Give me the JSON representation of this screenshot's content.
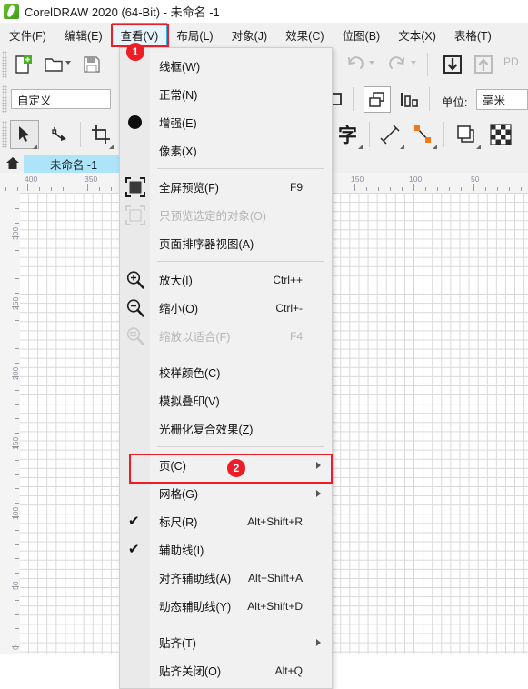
{
  "window": {
    "title": "CorelDRAW 2020 (64-Bit) - 未命名 -1",
    "logo_icon": "coreldraw-balloon-icon"
  },
  "menubar": {
    "items": [
      {
        "label": "文件(F)",
        "open": false
      },
      {
        "label": "编辑(E)",
        "open": false
      },
      {
        "label": "查看(V)",
        "open": true
      },
      {
        "label": "布局(L)",
        "open": false
      },
      {
        "label": "对象(J)",
        "open": false
      },
      {
        "label": "效果(C)",
        "open": false
      },
      {
        "label": "位图(B)",
        "open": false
      },
      {
        "label": "文本(X)",
        "open": false
      },
      {
        "label": "表格(T)",
        "open": false
      }
    ]
  },
  "toolbar": {
    "new_icon": "new-document-icon",
    "open_icon": "open-folder-icon",
    "save_icon": "save-disk-icon",
    "undo_icon": "undo-arrow-icon",
    "redo_icon": "redo-arrow-icon",
    "import_icon": "import-down-arrow-icon",
    "export_icon": "export-up-arrow-icon",
    "pdf_icon": "publish-pdf-icon",
    "preset_value": "自定义",
    "units_label": "单位:",
    "units_value": "毫米",
    "pick_tool_icon": "pick-tool-arrow-icon",
    "shape_tool_icon": "shape-tool-node-icon",
    "crop_tool_icon": "crop-tool-icon",
    "rect_tool_icon": "rectangle-tool-icon",
    "order_icon": "order-objects-icon",
    "align_icon": "align-distribute-icon",
    "text_tool_icon": "text-tool-icon",
    "dimension_icon": "dimension-line-icon",
    "connector_icon": "connector-tool-icon",
    "shadow_icon": "drop-shadow-icon",
    "transparency_icon": "transparency-checker-icon"
  },
  "document_tab": {
    "home_icon": "home-icon",
    "label": "未命名 -1"
  },
  "rulers": {
    "horizontal_labels": [
      "400",
      "350",
      "150",
      "100",
      "50"
    ],
    "vertical_labels": [
      "300",
      "250",
      "200",
      "150",
      "100",
      "50",
      "0"
    ]
  },
  "view_menu": {
    "groups": [
      {
        "items": [
          {
            "label": "线框(W)",
            "accel": "",
            "icon": "",
            "checked": false,
            "disabled": false,
            "submenu": false
          },
          {
            "label": "正常(N)",
            "accel": "",
            "icon": "",
            "checked": false,
            "disabled": false,
            "submenu": false
          },
          {
            "label": "增强(E)",
            "accel": "",
            "icon": "enhanced-circle-icon",
            "checked": false,
            "disabled": false,
            "submenu": false
          },
          {
            "label": "像素(X)",
            "accel": "",
            "icon": "",
            "checked": false,
            "disabled": false,
            "submenu": false
          }
        ]
      },
      {
        "items": [
          {
            "label": "全屏预览(F)",
            "accel": "F9",
            "icon": "fullscreen-preview-icon",
            "checked": false,
            "disabled": false,
            "submenu": false
          },
          {
            "label": "只预览选定的对象(O)",
            "accel": "",
            "icon": "preview-selected-icon",
            "checked": false,
            "disabled": true,
            "submenu": false
          },
          {
            "label": "页面排序器视图(A)",
            "accel": "",
            "icon": "",
            "checked": false,
            "disabled": false,
            "submenu": false
          }
        ]
      },
      {
        "items": [
          {
            "label": "放大(I)",
            "accel": "Ctrl++",
            "icon": "zoom-in-icon",
            "checked": false,
            "disabled": false,
            "submenu": false
          },
          {
            "label": "缩小(O)",
            "accel": "Ctrl+-",
            "icon": "zoom-out-icon",
            "checked": false,
            "disabled": false,
            "submenu": false
          },
          {
            "label": "缩放以适合(F)",
            "accel": "F4",
            "icon": "zoom-fit-icon",
            "checked": false,
            "disabled": true,
            "submenu": false
          }
        ]
      },
      {
        "items": [
          {
            "label": "校样颜色(C)",
            "accel": "",
            "icon": "",
            "checked": false,
            "disabled": false,
            "submenu": false
          },
          {
            "label": "模拟叠印(V)",
            "accel": "",
            "icon": "",
            "checked": false,
            "disabled": false,
            "submenu": false
          },
          {
            "label": "光栅化复合效果(Z)",
            "accel": "",
            "icon": "",
            "checked": false,
            "disabled": false,
            "submenu": false
          }
        ]
      },
      {
        "items": [
          {
            "label": "页(C)",
            "accel": "",
            "icon": "",
            "checked": false,
            "disabled": false,
            "submenu": true
          },
          {
            "label": "网格(G)",
            "accel": "",
            "icon": "",
            "checked": false,
            "disabled": false,
            "submenu": true,
            "highlighted": true
          },
          {
            "label": "标尺(R)",
            "accel": "Alt+Shift+R",
            "icon": "",
            "checked": true,
            "disabled": false,
            "submenu": false
          },
          {
            "label": "辅助线(I)",
            "accel": "",
            "icon": "",
            "checked": true,
            "disabled": false,
            "submenu": false
          },
          {
            "label": "对齐辅助线(A)",
            "accel": "Alt+Shift+A",
            "icon": "",
            "checked": false,
            "disabled": false,
            "submenu": false
          },
          {
            "label": "动态辅助线(Y)",
            "accel": "Alt+Shift+D",
            "icon": "",
            "checked": false,
            "disabled": false,
            "submenu": false
          }
        ]
      },
      {
        "items": [
          {
            "label": "贴齐(T)",
            "accel": "",
            "icon": "",
            "checked": false,
            "disabled": false,
            "submenu": true
          },
          {
            "label": "贴齐关闭(O)",
            "accel": "Alt+Q",
            "icon": "",
            "checked": false,
            "disabled": false,
            "submenu": false
          }
        ]
      }
    ]
  },
  "annotations": {
    "badge_1": "1",
    "badge_2": "2",
    "highlight_color": "#ee1c25"
  }
}
